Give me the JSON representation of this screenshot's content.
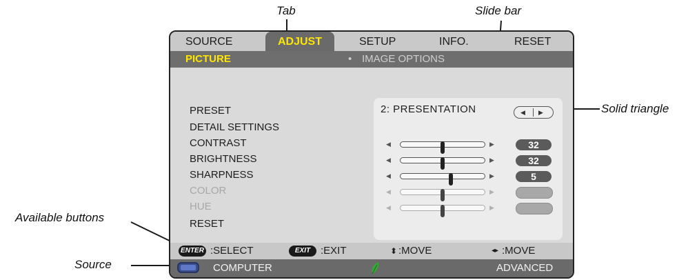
{
  "callouts": {
    "tab": "Tab",
    "slide_bar": "Slide bar",
    "solid_triangle": "Solid triangle",
    "available_buttons": "Available buttons",
    "source": "Source"
  },
  "tabs": [
    {
      "label": "SOURCE",
      "active": false
    },
    {
      "label": "ADJUST",
      "active": true
    },
    {
      "label": "SETUP",
      "active": false
    },
    {
      "label": "INFO.",
      "active": false
    },
    {
      "label": "RESET",
      "active": false
    }
  ],
  "subtabs": {
    "active": "PICTURE",
    "bullet": "•",
    "other": "IMAGE OPTIONS"
  },
  "menu": [
    {
      "label": "PRESET",
      "enabled": true
    },
    {
      "label": "DETAIL SETTINGS",
      "enabled": true
    },
    {
      "label": "CONTRAST",
      "enabled": true
    },
    {
      "label": "BRIGHTNESS",
      "enabled": true
    },
    {
      "label": "SHARPNESS",
      "enabled": true
    },
    {
      "label": "COLOR",
      "enabled": false
    },
    {
      "label": "HUE",
      "enabled": false
    },
    {
      "label": "RESET",
      "enabled": true
    }
  ],
  "preset_value": "2:  PRESENTATION",
  "sliders": [
    {
      "name": "contrast",
      "value": "32",
      "level": 0.5,
      "enabled": true
    },
    {
      "name": "brightness",
      "value": "32",
      "level": 0.5,
      "enabled": true
    },
    {
      "name": "sharpness",
      "value": "5",
      "level": 0.6,
      "enabled": true
    },
    {
      "name": "color",
      "value": "",
      "level": 0.5,
      "enabled": false
    },
    {
      "name": "hue",
      "value": "",
      "level": 0.5,
      "enabled": false
    }
  ],
  "help": {
    "enter_key": "ENTER",
    "select": ":SELECT",
    "exit_key": "EXIT",
    "exit": ":EXIT",
    "updown_icon": "⬍",
    "move1": ":MOVE",
    "leftright_icon": "◂▸",
    "move2": ":MOVE"
  },
  "status": {
    "source": "COMPUTER",
    "mode": "ADVANCED",
    "eco_icon": "leaf-icon"
  },
  "colors": {
    "active_tab_text": "#ffe600",
    "eco_leaf": "#3aa33a"
  }
}
